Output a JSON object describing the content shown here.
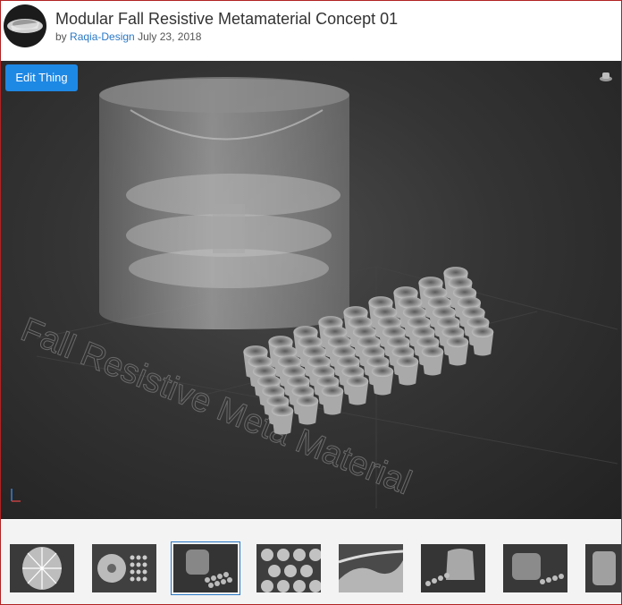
{
  "header": {
    "title": "Modular Fall Resistive Metamaterial Concept 01",
    "by_prefix": "by",
    "author": "Raqia-Design",
    "date": "July 23, 2018"
  },
  "viewer": {
    "edit_label": "Edit Thing",
    "watermark_text": "Fall Resistive Meta Material"
  },
  "thumbnails": {
    "count": 8,
    "active_index": 2
  },
  "colors": {
    "accent": "#1e88e5",
    "link": "#2a78c6",
    "frame_border": "#b22222"
  }
}
